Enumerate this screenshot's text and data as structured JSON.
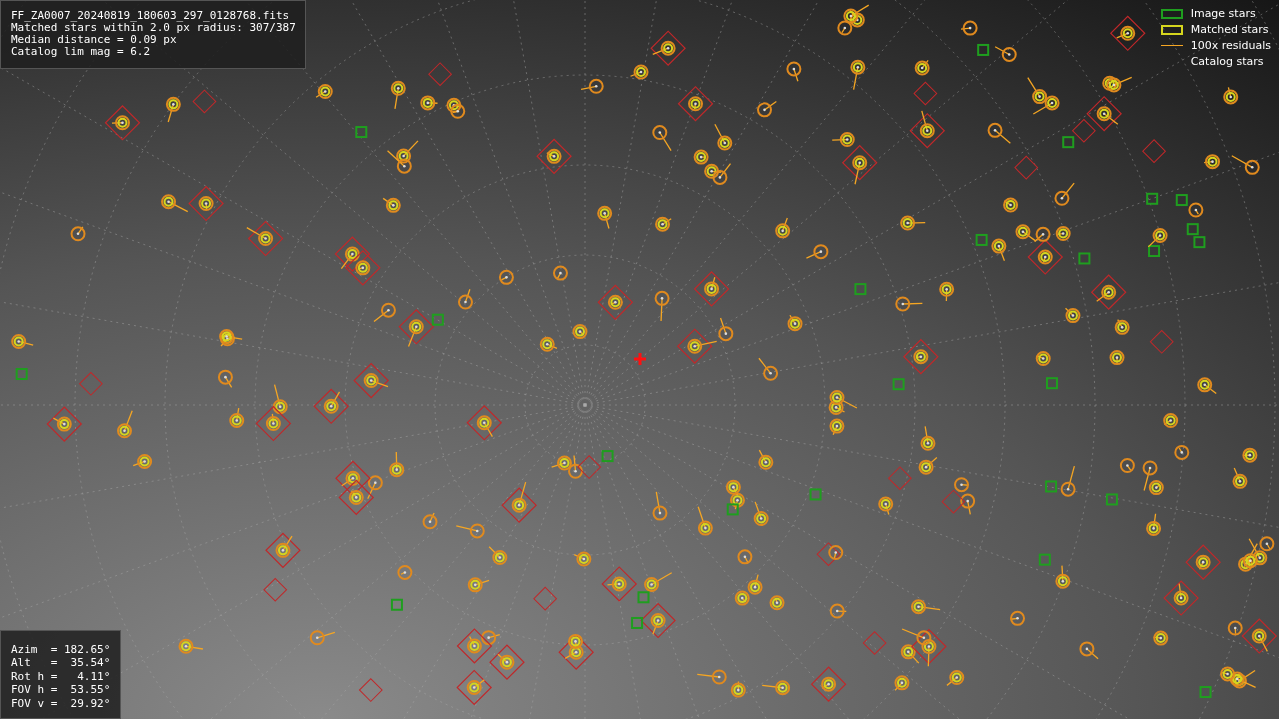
{
  "info_panel": {
    "lines": [
      "FF_ZA0007_20240819_180603_297_0128768.fits",
      "Matched stars within 2.0 px radius: 307/387",
      "Median distance = 0.09 px",
      "Catalog lim mag = 6.2"
    ]
  },
  "legend": [
    {
      "kind": "square",
      "color": "#1f9e1f",
      "label": "Image stars"
    },
    {
      "kind": "square",
      "color": "#d6d61e",
      "label": "Matched stars"
    },
    {
      "kind": "line",
      "color": "#f5a623",
      "label": "100x residuals"
    },
    {
      "kind": "none",
      "label": "Catalog stars"
    }
  ],
  "pointing_panel": {
    "lines": [
      "Azim  = 182.65°",
      "Alt   =  35.54°",
      "Rot h =   4.11°",
      "FOV h =  53.55°",
      "FOV v =  29.92°"
    ]
  }
}
